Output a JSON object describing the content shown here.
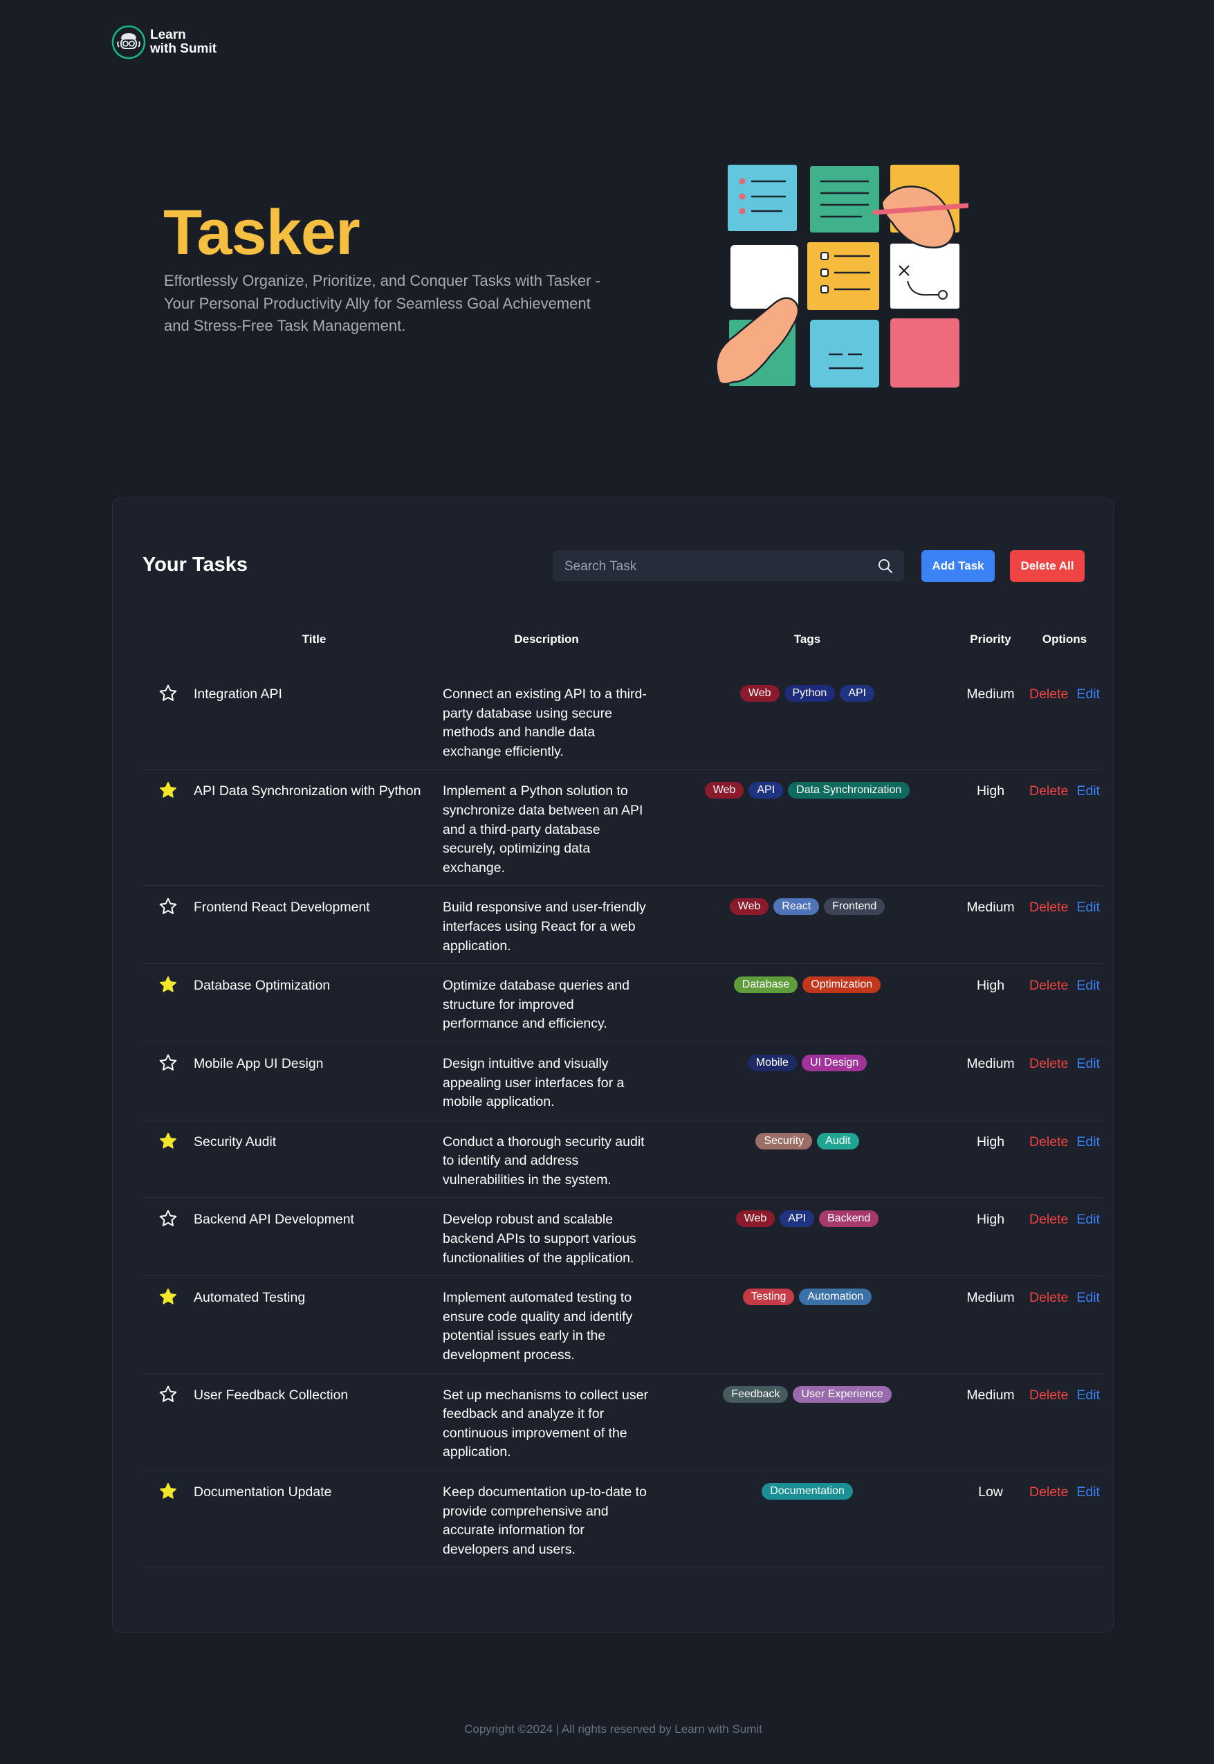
{
  "logo": {
    "line1": "Learn",
    "line2": "with Sumit"
  },
  "hero": {
    "title": "Tasker",
    "subtitle": "Effortlessly Organize, Prioritize, and Conquer Tasks with Tasker - Your Personal Productivity Ally for Seamless Goal Achievement and Stress-Free Task Management."
  },
  "tasks_panel": {
    "title": "Your Tasks",
    "search_placeholder": "Search Task",
    "add_label": "Add Task",
    "delete_all_label": "Delete All",
    "columns": [
      "Title",
      "Description",
      "Tags",
      "Priority",
      "Options"
    ],
    "delete_label": "Delete",
    "edit_label": "Edit"
  },
  "tasks": [
    {
      "favorite": false,
      "title": "Integration API",
      "description": "Connect an existing API to a third-party database using secure methods and handle data exchange efficiently.",
      "tags": [
        {
          "label": "Web",
          "color": "#8b1a2b"
        },
        {
          "label": "Python",
          "color": "#1e2a7a"
        },
        {
          "label": "API",
          "color": "#1f3480"
        }
      ],
      "priority": "Medium"
    },
    {
      "favorite": true,
      "title": "API Data Synchronization with Python",
      "description": "Implement a Python solution to synchronize data between an API and a third-party database securely, optimizing data exchange.",
      "tags": [
        {
          "label": "Web",
          "color": "#8b1a2b"
        },
        {
          "label": "API",
          "color": "#1f3480"
        },
        {
          "label": "Data Synchronization",
          "color": "#0f6b5d"
        }
      ],
      "priority": "High"
    },
    {
      "favorite": false,
      "title": "Frontend React Development",
      "description": "Build responsive and user-friendly interfaces using React for a web application.",
      "tags": [
        {
          "label": "Web",
          "color": "#8b1a2b"
        },
        {
          "label": "React",
          "color": "#4f74b8"
        },
        {
          "label": "Frontend",
          "color": "#3c4456"
        }
      ],
      "priority": "Medium"
    },
    {
      "favorite": true,
      "title": "Database Optimization",
      "description": "Optimize database queries and structure for improved performance and efficiency.",
      "tags": [
        {
          "label": "Database",
          "color": "#5e9d3a"
        },
        {
          "label": "Optimization",
          "color": "#c2361b"
        }
      ],
      "priority": "High"
    },
    {
      "favorite": false,
      "title": "Mobile App UI Design",
      "description": "Design intuitive and visually appealing user interfaces for a mobile application.",
      "tags": [
        {
          "label": "Mobile",
          "color": "#1e2a66"
        },
        {
          "label": "UI Design",
          "color": "#a0349b"
        }
      ],
      "priority": "Medium"
    },
    {
      "favorite": true,
      "title": "Security Audit",
      "description": "Conduct a thorough security audit to identify and address vulnerabilities in the system.",
      "tags": [
        {
          "label": "Security",
          "color": "#9b6f66"
        },
        {
          "label": "Audit",
          "color": "#1fa591"
        }
      ],
      "priority": "High"
    },
    {
      "favorite": false,
      "title": "Backend API Development",
      "description": "Develop robust and scalable backend APIs to support various functionalities of the application.",
      "tags": [
        {
          "label": "Web",
          "color": "#8b1a2b"
        },
        {
          "label": "API",
          "color": "#1f3480"
        },
        {
          "label": "Backend",
          "color": "#a8396d"
        }
      ],
      "priority": "High"
    },
    {
      "favorite": true,
      "title": "Automated Testing",
      "description": "Implement automated testing to ensure code quality and identify potential issues early in the development process.",
      "tags": [
        {
          "label": "Testing",
          "color": "#c63c46"
        },
        {
          "label": "Automation",
          "color": "#3a72a8"
        }
      ],
      "priority": "Medium"
    },
    {
      "favorite": false,
      "title": "User Feedback Collection",
      "description": "Set up mechanisms to collect user feedback and analyze it for continuous improvement of the application.",
      "tags": [
        {
          "label": "Feedback",
          "color": "#475a5e"
        },
        {
          "label": "User Experience",
          "color": "#9a6aae"
        }
      ],
      "priority": "Medium"
    },
    {
      "favorite": true,
      "title": "Documentation Update",
      "description": "Keep documentation up-to-date to provide comprehensive and accurate information for developers and users.",
      "tags": [
        {
          "label": "Documentation",
          "color": "#1a8f95"
        }
      ],
      "priority": "Low"
    }
  ],
  "footer": {
    "text": "Copyright ©2024 | All rights reserved by Learn with Sumit"
  },
  "colors": {
    "background": "#191d26",
    "panel": "#1d212b",
    "accent_title": "#f5bf42",
    "primary": "#3b82f6",
    "danger": "#ef4444",
    "star_active": "#f3e62b"
  }
}
